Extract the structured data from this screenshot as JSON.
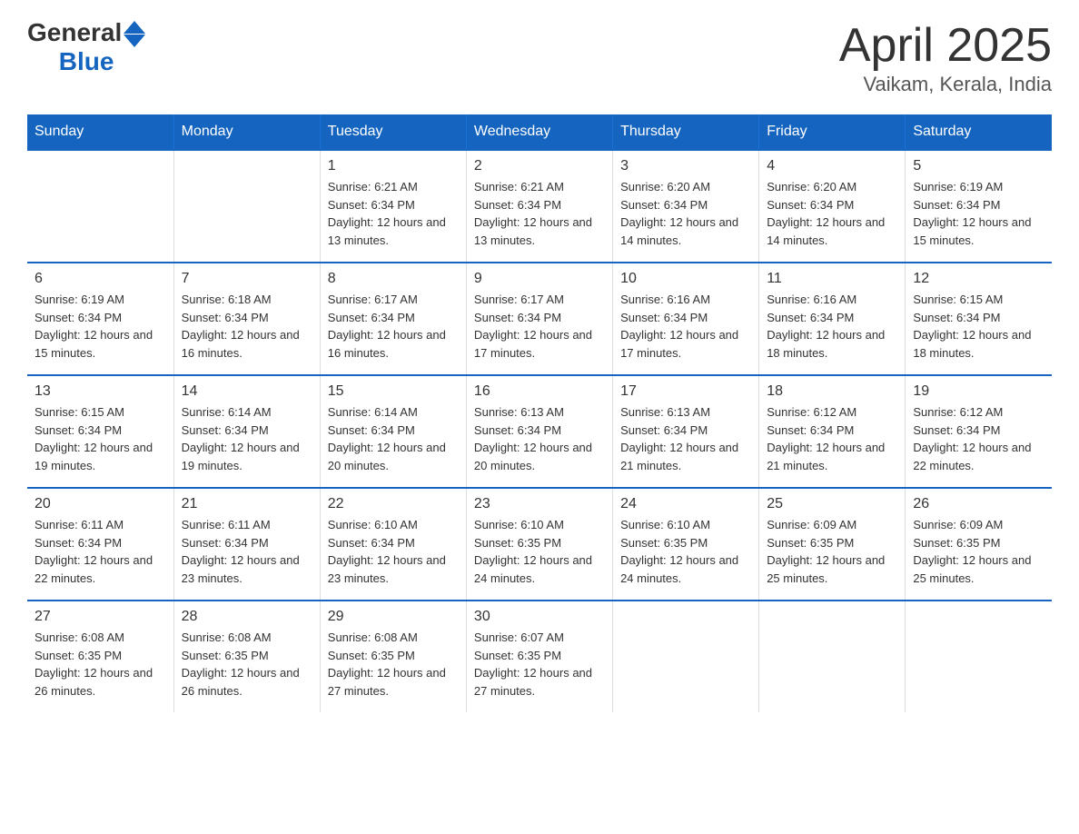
{
  "header": {
    "logo_general": "General",
    "logo_blue": "Blue",
    "title": "April 2025",
    "subtitle": "Vaikam, Kerala, India"
  },
  "weekdays": [
    "Sunday",
    "Monday",
    "Tuesday",
    "Wednesday",
    "Thursday",
    "Friday",
    "Saturday"
  ],
  "weeks": [
    [
      {
        "day": "",
        "sunrise": "",
        "sunset": "",
        "daylight": ""
      },
      {
        "day": "",
        "sunrise": "",
        "sunset": "",
        "daylight": ""
      },
      {
        "day": "1",
        "sunrise": "Sunrise: 6:21 AM",
        "sunset": "Sunset: 6:34 PM",
        "daylight": "Daylight: 12 hours and 13 minutes."
      },
      {
        "day": "2",
        "sunrise": "Sunrise: 6:21 AM",
        "sunset": "Sunset: 6:34 PM",
        "daylight": "Daylight: 12 hours and 13 minutes."
      },
      {
        "day": "3",
        "sunrise": "Sunrise: 6:20 AM",
        "sunset": "Sunset: 6:34 PM",
        "daylight": "Daylight: 12 hours and 14 minutes."
      },
      {
        "day": "4",
        "sunrise": "Sunrise: 6:20 AM",
        "sunset": "Sunset: 6:34 PM",
        "daylight": "Daylight: 12 hours and 14 minutes."
      },
      {
        "day": "5",
        "sunrise": "Sunrise: 6:19 AM",
        "sunset": "Sunset: 6:34 PM",
        "daylight": "Daylight: 12 hours and 15 minutes."
      }
    ],
    [
      {
        "day": "6",
        "sunrise": "Sunrise: 6:19 AM",
        "sunset": "Sunset: 6:34 PM",
        "daylight": "Daylight: 12 hours and 15 minutes."
      },
      {
        "day": "7",
        "sunrise": "Sunrise: 6:18 AM",
        "sunset": "Sunset: 6:34 PM",
        "daylight": "Daylight: 12 hours and 16 minutes."
      },
      {
        "day": "8",
        "sunrise": "Sunrise: 6:17 AM",
        "sunset": "Sunset: 6:34 PM",
        "daylight": "Daylight: 12 hours and 16 minutes."
      },
      {
        "day": "9",
        "sunrise": "Sunrise: 6:17 AM",
        "sunset": "Sunset: 6:34 PM",
        "daylight": "Daylight: 12 hours and 17 minutes."
      },
      {
        "day": "10",
        "sunrise": "Sunrise: 6:16 AM",
        "sunset": "Sunset: 6:34 PM",
        "daylight": "Daylight: 12 hours and 17 minutes."
      },
      {
        "day": "11",
        "sunrise": "Sunrise: 6:16 AM",
        "sunset": "Sunset: 6:34 PM",
        "daylight": "Daylight: 12 hours and 18 minutes."
      },
      {
        "day": "12",
        "sunrise": "Sunrise: 6:15 AM",
        "sunset": "Sunset: 6:34 PM",
        "daylight": "Daylight: 12 hours and 18 minutes."
      }
    ],
    [
      {
        "day": "13",
        "sunrise": "Sunrise: 6:15 AM",
        "sunset": "Sunset: 6:34 PM",
        "daylight": "Daylight: 12 hours and 19 minutes."
      },
      {
        "day": "14",
        "sunrise": "Sunrise: 6:14 AM",
        "sunset": "Sunset: 6:34 PM",
        "daylight": "Daylight: 12 hours and 19 minutes."
      },
      {
        "day": "15",
        "sunrise": "Sunrise: 6:14 AM",
        "sunset": "Sunset: 6:34 PM",
        "daylight": "Daylight: 12 hours and 20 minutes."
      },
      {
        "day": "16",
        "sunrise": "Sunrise: 6:13 AM",
        "sunset": "Sunset: 6:34 PM",
        "daylight": "Daylight: 12 hours and 20 minutes."
      },
      {
        "day": "17",
        "sunrise": "Sunrise: 6:13 AM",
        "sunset": "Sunset: 6:34 PM",
        "daylight": "Daylight: 12 hours and 21 minutes."
      },
      {
        "day": "18",
        "sunrise": "Sunrise: 6:12 AM",
        "sunset": "Sunset: 6:34 PM",
        "daylight": "Daylight: 12 hours and 21 minutes."
      },
      {
        "day": "19",
        "sunrise": "Sunrise: 6:12 AM",
        "sunset": "Sunset: 6:34 PM",
        "daylight": "Daylight: 12 hours and 22 minutes."
      }
    ],
    [
      {
        "day": "20",
        "sunrise": "Sunrise: 6:11 AM",
        "sunset": "Sunset: 6:34 PM",
        "daylight": "Daylight: 12 hours and 22 minutes."
      },
      {
        "day": "21",
        "sunrise": "Sunrise: 6:11 AM",
        "sunset": "Sunset: 6:34 PM",
        "daylight": "Daylight: 12 hours and 23 minutes."
      },
      {
        "day": "22",
        "sunrise": "Sunrise: 6:10 AM",
        "sunset": "Sunset: 6:34 PM",
        "daylight": "Daylight: 12 hours and 23 minutes."
      },
      {
        "day": "23",
        "sunrise": "Sunrise: 6:10 AM",
        "sunset": "Sunset: 6:35 PM",
        "daylight": "Daylight: 12 hours and 24 minutes."
      },
      {
        "day": "24",
        "sunrise": "Sunrise: 6:10 AM",
        "sunset": "Sunset: 6:35 PM",
        "daylight": "Daylight: 12 hours and 24 minutes."
      },
      {
        "day": "25",
        "sunrise": "Sunrise: 6:09 AM",
        "sunset": "Sunset: 6:35 PM",
        "daylight": "Daylight: 12 hours and 25 minutes."
      },
      {
        "day": "26",
        "sunrise": "Sunrise: 6:09 AM",
        "sunset": "Sunset: 6:35 PM",
        "daylight": "Daylight: 12 hours and 25 minutes."
      }
    ],
    [
      {
        "day": "27",
        "sunrise": "Sunrise: 6:08 AM",
        "sunset": "Sunset: 6:35 PM",
        "daylight": "Daylight: 12 hours and 26 minutes."
      },
      {
        "day": "28",
        "sunrise": "Sunrise: 6:08 AM",
        "sunset": "Sunset: 6:35 PM",
        "daylight": "Daylight: 12 hours and 26 minutes."
      },
      {
        "day": "29",
        "sunrise": "Sunrise: 6:08 AM",
        "sunset": "Sunset: 6:35 PM",
        "daylight": "Daylight: 12 hours and 27 minutes."
      },
      {
        "day": "30",
        "sunrise": "Sunrise: 6:07 AM",
        "sunset": "Sunset: 6:35 PM",
        "daylight": "Daylight: 12 hours and 27 minutes."
      },
      {
        "day": "",
        "sunrise": "",
        "sunset": "",
        "daylight": ""
      },
      {
        "day": "",
        "sunrise": "",
        "sunset": "",
        "daylight": ""
      },
      {
        "day": "",
        "sunrise": "",
        "sunset": "",
        "daylight": ""
      }
    ]
  ]
}
